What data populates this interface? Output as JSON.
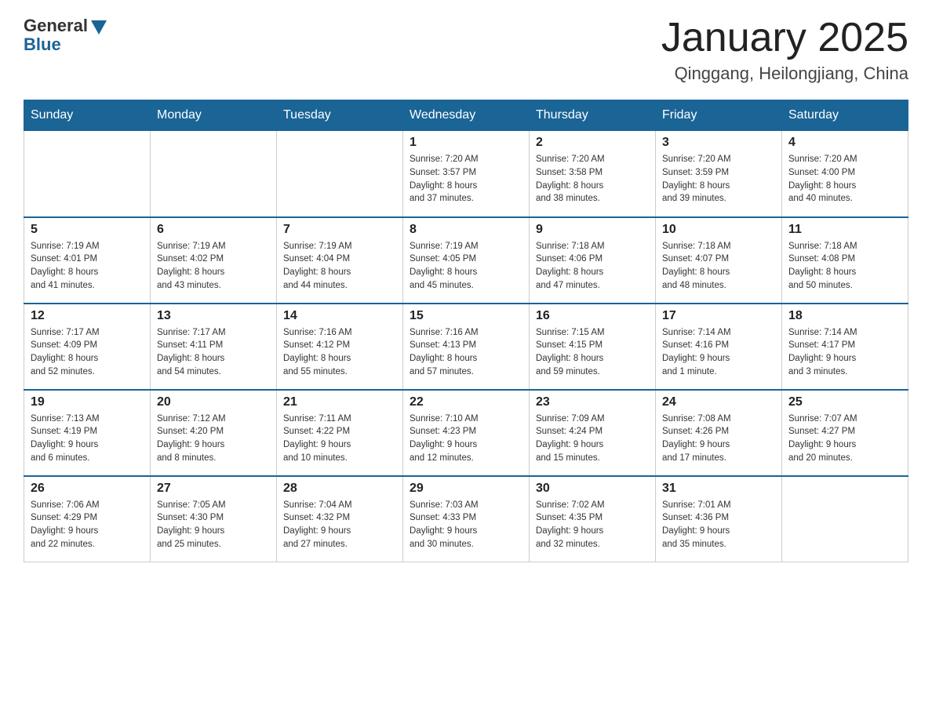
{
  "header": {
    "logo_general": "General",
    "logo_blue": "Blue",
    "month_year": "January 2025",
    "location": "Qinggang, Heilongjiang, China"
  },
  "weekdays": [
    "Sunday",
    "Monday",
    "Tuesday",
    "Wednesday",
    "Thursday",
    "Friday",
    "Saturday"
  ],
  "weeks": [
    [
      {
        "day": "",
        "info": ""
      },
      {
        "day": "",
        "info": ""
      },
      {
        "day": "",
        "info": ""
      },
      {
        "day": "1",
        "info": "Sunrise: 7:20 AM\nSunset: 3:57 PM\nDaylight: 8 hours\nand 37 minutes."
      },
      {
        "day": "2",
        "info": "Sunrise: 7:20 AM\nSunset: 3:58 PM\nDaylight: 8 hours\nand 38 minutes."
      },
      {
        "day": "3",
        "info": "Sunrise: 7:20 AM\nSunset: 3:59 PM\nDaylight: 8 hours\nand 39 minutes."
      },
      {
        "day": "4",
        "info": "Sunrise: 7:20 AM\nSunset: 4:00 PM\nDaylight: 8 hours\nand 40 minutes."
      }
    ],
    [
      {
        "day": "5",
        "info": "Sunrise: 7:19 AM\nSunset: 4:01 PM\nDaylight: 8 hours\nand 41 minutes."
      },
      {
        "day": "6",
        "info": "Sunrise: 7:19 AM\nSunset: 4:02 PM\nDaylight: 8 hours\nand 43 minutes."
      },
      {
        "day": "7",
        "info": "Sunrise: 7:19 AM\nSunset: 4:04 PM\nDaylight: 8 hours\nand 44 minutes."
      },
      {
        "day": "8",
        "info": "Sunrise: 7:19 AM\nSunset: 4:05 PM\nDaylight: 8 hours\nand 45 minutes."
      },
      {
        "day": "9",
        "info": "Sunrise: 7:18 AM\nSunset: 4:06 PM\nDaylight: 8 hours\nand 47 minutes."
      },
      {
        "day": "10",
        "info": "Sunrise: 7:18 AM\nSunset: 4:07 PM\nDaylight: 8 hours\nand 48 minutes."
      },
      {
        "day": "11",
        "info": "Sunrise: 7:18 AM\nSunset: 4:08 PM\nDaylight: 8 hours\nand 50 minutes."
      }
    ],
    [
      {
        "day": "12",
        "info": "Sunrise: 7:17 AM\nSunset: 4:09 PM\nDaylight: 8 hours\nand 52 minutes."
      },
      {
        "day": "13",
        "info": "Sunrise: 7:17 AM\nSunset: 4:11 PM\nDaylight: 8 hours\nand 54 minutes."
      },
      {
        "day": "14",
        "info": "Sunrise: 7:16 AM\nSunset: 4:12 PM\nDaylight: 8 hours\nand 55 minutes."
      },
      {
        "day": "15",
        "info": "Sunrise: 7:16 AM\nSunset: 4:13 PM\nDaylight: 8 hours\nand 57 minutes."
      },
      {
        "day": "16",
        "info": "Sunrise: 7:15 AM\nSunset: 4:15 PM\nDaylight: 8 hours\nand 59 minutes."
      },
      {
        "day": "17",
        "info": "Sunrise: 7:14 AM\nSunset: 4:16 PM\nDaylight: 9 hours\nand 1 minute."
      },
      {
        "day": "18",
        "info": "Sunrise: 7:14 AM\nSunset: 4:17 PM\nDaylight: 9 hours\nand 3 minutes."
      }
    ],
    [
      {
        "day": "19",
        "info": "Sunrise: 7:13 AM\nSunset: 4:19 PM\nDaylight: 9 hours\nand 6 minutes."
      },
      {
        "day": "20",
        "info": "Sunrise: 7:12 AM\nSunset: 4:20 PM\nDaylight: 9 hours\nand 8 minutes."
      },
      {
        "day": "21",
        "info": "Sunrise: 7:11 AM\nSunset: 4:22 PM\nDaylight: 9 hours\nand 10 minutes."
      },
      {
        "day": "22",
        "info": "Sunrise: 7:10 AM\nSunset: 4:23 PM\nDaylight: 9 hours\nand 12 minutes."
      },
      {
        "day": "23",
        "info": "Sunrise: 7:09 AM\nSunset: 4:24 PM\nDaylight: 9 hours\nand 15 minutes."
      },
      {
        "day": "24",
        "info": "Sunrise: 7:08 AM\nSunset: 4:26 PM\nDaylight: 9 hours\nand 17 minutes."
      },
      {
        "day": "25",
        "info": "Sunrise: 7:07 AM\nSunset: 4:27 PM\nDaylight: 9 hours\nand 20 minutes."
      }
    ],
    [
      {
        "day": "26",
        "info": "Sunrise: 7:06 AM\nSunset: 4:29 PM\nDaylight: 9 hours\nand 22 minutes."
      },
      {
        "day": "27",
        "info": "Sunrise: 7:05 AM\nSunset: 4:30 PM\nDaylight: 9 hours\nand 25 minutes."
      },
      {
        "day": "28",
        "info": "Sunrise: 7:04 AM\nSunset: 4:32 PM\nDaylight: 9 hours\nand 27 minutes."
      },
      {
        "day": "29",
        "info": "Sunrise: 7:03 AM\nSunset: 4:33 PM\nDaylight: 9 hours\nand 30 minutes."
      },
      {
        "day": "30",
        "info": "Sunrise: 7:02 AM\nSunset: 4:35 PM\nDaylight: 9 hours\nand 32 minutes."
      },
      {
        "day": "31",
        "info": "Sunrise: 7:01 AM\nSunset: 4:36 PM\nDaylight: 9 hours\nand 35 minutes."
      },
      {
        "day": "",
        "info": ""
      }
    ]
  ]
}
